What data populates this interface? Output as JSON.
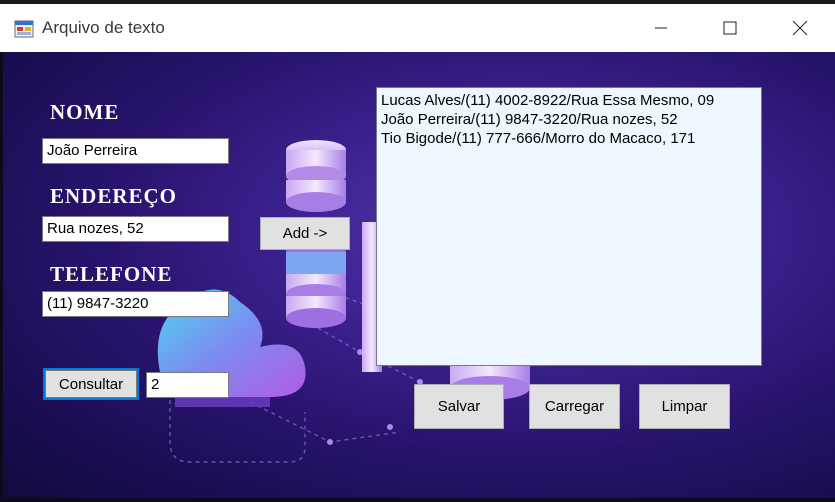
{
  "window": {
    "title": "Arquivo de texto"
  },
  "form": {
    "nome_label": "NOME",
    "nome_value": "João Perreira",
    "endereco_label": "ENDEREÇO",
    "endereco_value": "Rua nozes, 52",
    "telefone_label": "TELEFONE",
    "telefone_value": "(11) 9847-3220",
    "consultar_label": "Consultar",
    "consultar_value": "2",
    "add_label": "Add ->"
  },
  "list": {
    "items": [
      "Lucas Alves/(11) 4002-8922/Rua Essa Mesmo, 09",
      "João Perreira/(11) 9847-3220/Rua nozes, 52",
      "Tio Bigode/(11) 777-666/Morro do Macaco, 171"
    ]
  },
  "actions": {
    "salvar_label": "Salvar",
    "carregar_label": "Carregar",
    "limpar_label": "Limpar"
  },
  "icons": {
    "app": "form-app-icon",
    "minimize": "minimize-icon",
    "maximize": "maximize-icon",
    "close": "close-icon"
  },
  "colors": {
    "background": "#2a1470",
    "listbox": "#eef6ff",
    "focus": "#0078d7"
  }
}
